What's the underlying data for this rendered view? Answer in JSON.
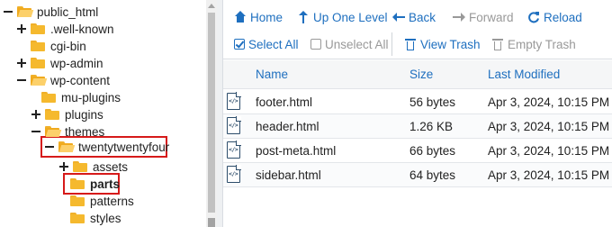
{
  "tree": {
    "items": [
      {
        "label": "public_html",
        "expander": "minus",
        "bold": false
      },
      {
        "label": ".well-known",
        "expander": "plus",
        "bold": false
      },
      {
        "label": "cgi-bin",
        "expander": "none",
        "bold": false
      },
      {
        "label": "wp-admin",
        "expander": "plus",
        "bold": false
      },
      {
        "label": "wp-content",
        "expander": "minus",
        "bold": false
      },
      {
        "label": "mu-plugins",
        "expander": "none",
        "bold": false
      },
      {
        "label": "plugins",
        "expander": "plus",
        "bold": false
      },
      {
        "label": "themes",
        "expander": "minus",
        "bold": false
      },
      {
        "label": "twentytwentyfour",
        "expander": "minus",
        "bold": false
      },
      {
        "label": "assets",
        "expander": "plus",
        "bold": false
      },
      {
        "label": "parts",
        "expander": "none",
        "bold": true
      },
      {
        "label": "patterns",
        "expander": "none",
        "bold": false
      },
      {
        "label": "styles",
        "expander": "none",
        "bold": false
      }
    ]
  },
  "toolbar": {
    "home": "Home",
    "up_one_level": "Up One Level",
    "back": "Back",
    "forward": "Forward",
    "reload": "Reload",
    "select_all": "Select All",
    "unselect_all": "Unselect All",
    "view_trash": "View Trash",
    "empty_trash": "Empty Trash"
  },
  "table": {
    "columns": [
      "Name",
      "Size",
      "Last Modified"
    ],
    "rows": [
      {
        "name": "footer.html",
        "size": "56 bytes",
        "modified": "Apr 3, 2024, 10:15 PM"
      },
      {
        "name": "header.html",
        "size": "1.26 KB",
        "modified": "Apr 3, 2024, 10:15 PM"
      },
      {
        "name": "post-meta.html",
        "size": "66 bytes",
        "modified": "Apr 3, 2024, 10:15 PM"
      },
      {
        "name": "sidebar.html",
        "size": "64 bytes",
        "modified": "Apr 3, 2024, 10:15 PM"
      }
    ]
  },
  "colors": {
    "accent": "#1e6fbf",
    "disabled": "#999999",
    "highlight": "#d61a1a",
    "folder": "#f5b92e"
  }
}
